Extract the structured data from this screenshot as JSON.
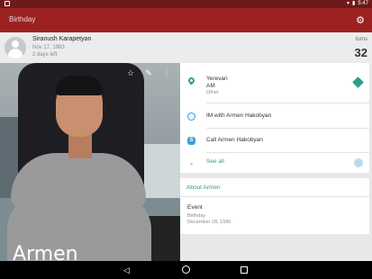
{
  "status_bar": {
    "time": "5:47"
  },
  "app_bar": {
    "title": "Birthday"
  },
  "contact": {
    "name": "Siranush Karapetyan",
    "date": "Nov 17, 1983",
    "days_left": "2 days left",
    "turns_label": "turns",
    "turns_value": "32"
  },
  "photo": {
    "overlay_name": "Armen"
  },
  "details": {
    "location": {
      "line1": "Yerevan",
      "line2": "AM",
      "type": "Other"
    },
    "im": "IM with Armen Hakobyan",
    "call": "Call Armen Hakobyan",
    "see_all": "See all"
  },
  "about": {
    "header": "About Armen",
    "event_title": "Event",
    "event_type": "Birthday",
    "event_date": "December 28, 1990"
  },
  "colors": {
    "app_bar": "#9c2222",
    "status_bar": "#6d1a1a",
    "accent": "#2e9c8c"
  }
}
